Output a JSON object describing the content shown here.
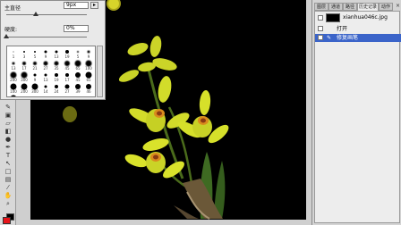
{
  "brush_panel": {
    "diameter_label": "主直径",
    "diameter_value": "9px",
    "hardness_label": "硬度:",
    "hardness_value": "0%",
    "presets": [
      {
        "size": 1,
        "label": "1"
      },
      {
        "size": 3,
        "label": "3"
      },
      {
        "size": 5,
        "label": "5"
      },
      {
        "size": 9,
        "label": "9"
      },
      {
        "size": 13,
        "label": "13"
      },
      {
        "size": 19,
        "label": "19"
      },
      {
        "size": 5,
        "label": "5"
      },
      {
        "size": 9,
        "label": "9"
      },
      {
        "size": 13,
        "label": "13"
      },
      {
        "size": 17,
        "label": "17"
      },
      {
        "size": 21,
        "label": "21"
      },
      {
        "size": 27,
        "label": "27"
      },
      {
        "size": 35,
        "label": "35"
      },
      {
        "size": 45,
        "label": "45"
      },
      {
        "size": 65,
        "label": "65"
      },
      {
        "size": 100,
        "label": "100"
      },
      {
        "size": 200,
        "label": "200"
      },
      {
        "size": 300,
        "label": "300"
      },
      {
        "size": 9,
        "label": "9"
      },
      {
        "size": 13,
        "label": "13"
      },
      {
        "size": 19,
        "label": "19"
      },
      {
        "size": 17,
        "label": "17"
      },
      {
        "size": 45,
        "label": "45"
      },
      {
        "size": 65,
        "label": "65"
      },
      {
        "size": 100,
        "label": "100"
      },
      {
        "size": 200,
        "label": "200"
      },
      {
        "size": 300,
        "label": "300"
      },
      {
        "size": 14,
        "label": "14"
      },
      {
        "size": 24,
        "label": "24"
      },
      {
        "size": 27,
        "label": "27"
      },
      {
        "size": 39,
        "label": "39"
      },
      {
        "size": 46,
        "label": "46"
      },
      {
        "size": 59,
        "label": "59"
      },
      {
        "size": 11,
        "label": "11"
      },
      {
        "size": 17,
        "label": "17"
      },
      {
        "size": 23,
        "label": "23"
      }
    ]
  },
  "history_panel": {
    "tabs": [
      "图层",
      "通道",
      "路径",
      "历史记录",
      "动作"
    ],
    "active_tab": "历史记录",
    "snapshot_name": "xianhua046c.jpg",
    "steps": [
      {
        "label": "打开",
        "active": false
      },
      {
        "label": "修复画笔",
        "active": true
      }
    ]
  },
  "toolbox": {
    "icons": [
      "brush-tool-icon",
      "stamp-tool-icon",
      "eraser-tool-icon",
      "gradient-tool-icon",
      "dodge-tool-icon",
      "pen-tool-icon",
      "text-tool-icon",
      "selection-tool-icon",
      "shape-tool-icon",
      "notes-tool-icon",
      "eyedropper-tool-icon",
      "hand-tool-icon",
      "zoom-tool-icon"
    ],
    "foreground_color": "#e8141a",
    "background_color": "#000000"
  },
  "colors": {
    "selection_blue": "#3b64c9",
    "orchid_yellow": "#d6e02a",
    "canvas_bg": "#000000"
  }
}
